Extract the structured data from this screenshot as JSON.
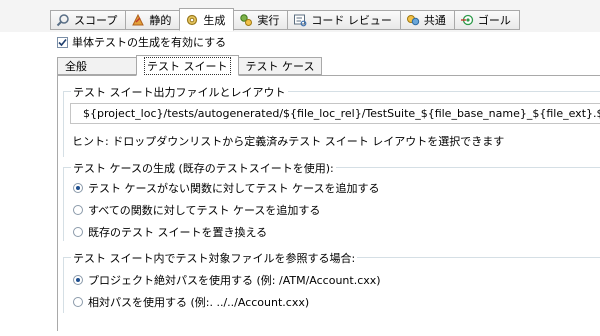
{
  "top_tabs": [
    {
      "label": "スコープ",
      "icon": "scope-icon"
    },
    {
      "label": "静的",
      "icon": "static-icon"
    },
    {
      "label": "生成",
      "icon": "generate-icon"
    },
    {
      "label": "実行",
      "icon": "execute-icon"
    },
    {
      "label": "コード レビュー",
      "icon": "code-review-icon"
    },
    {
      "label": "共通",
      "icon": "common-icon"
    },
    {
      "label": "ゴール",
      "icon": "goal-icon"
    }
  ],
  "enable_checkbox": {
    "label": "単体テストの生成を有効にする",
    "checked": true
  },
  "sub_tabs": [
    {
      "label": "全般"
    },
    {
      "label": "テスト スイート"
    },
    {
      "label": "テスト ケース"
    }
  ],
  "output_group": {
    "title": "テスト スイート出力ファイルとレイアウト",
    "path_value": "${project_loc}/tests/autogenerated/${file_loc_rel}/TestSuite_${file_base_name}_${file_ext}.${file_ext}",
    "hint": "ヒント: ドロップダウンリストから定義済みテスト スイート レイアウトを選択できます"
  },
  "case_group": {
    "title": "テスト ケースの生成 (既存のテストスイートを使用):",
    "options": [
      {
        "label": "テスト ケースがない関数に対してテスト ケースを追加する",
        "selected": true
      },
      {
        "label": "すべての関数に対してテスト ケースを追加する",
        "selected": false
      },
      {
        "label": "既存のテスト スイートを置き換える",
        "selected": false
      }
    ]
  },
  "ref_group": {
    "title": "テスト スイート内でテスト対象ファイルを参照する場合:",
    "options": [
      {
        "label": "プロジェクト絶対パスを使用する (例: /ATM/Account.cxx)",
        "selected": true
      },
      {
        "label": "相対パスを使用する (例:. ../../Account.cxx)",
        "selected": false
      }
    ]
  },
  "colors": {
    "accent": "#1f4f8f",
    "tab_border": "#a9a9a9",
    "group_line": "#d5dfe5"
  }
}
